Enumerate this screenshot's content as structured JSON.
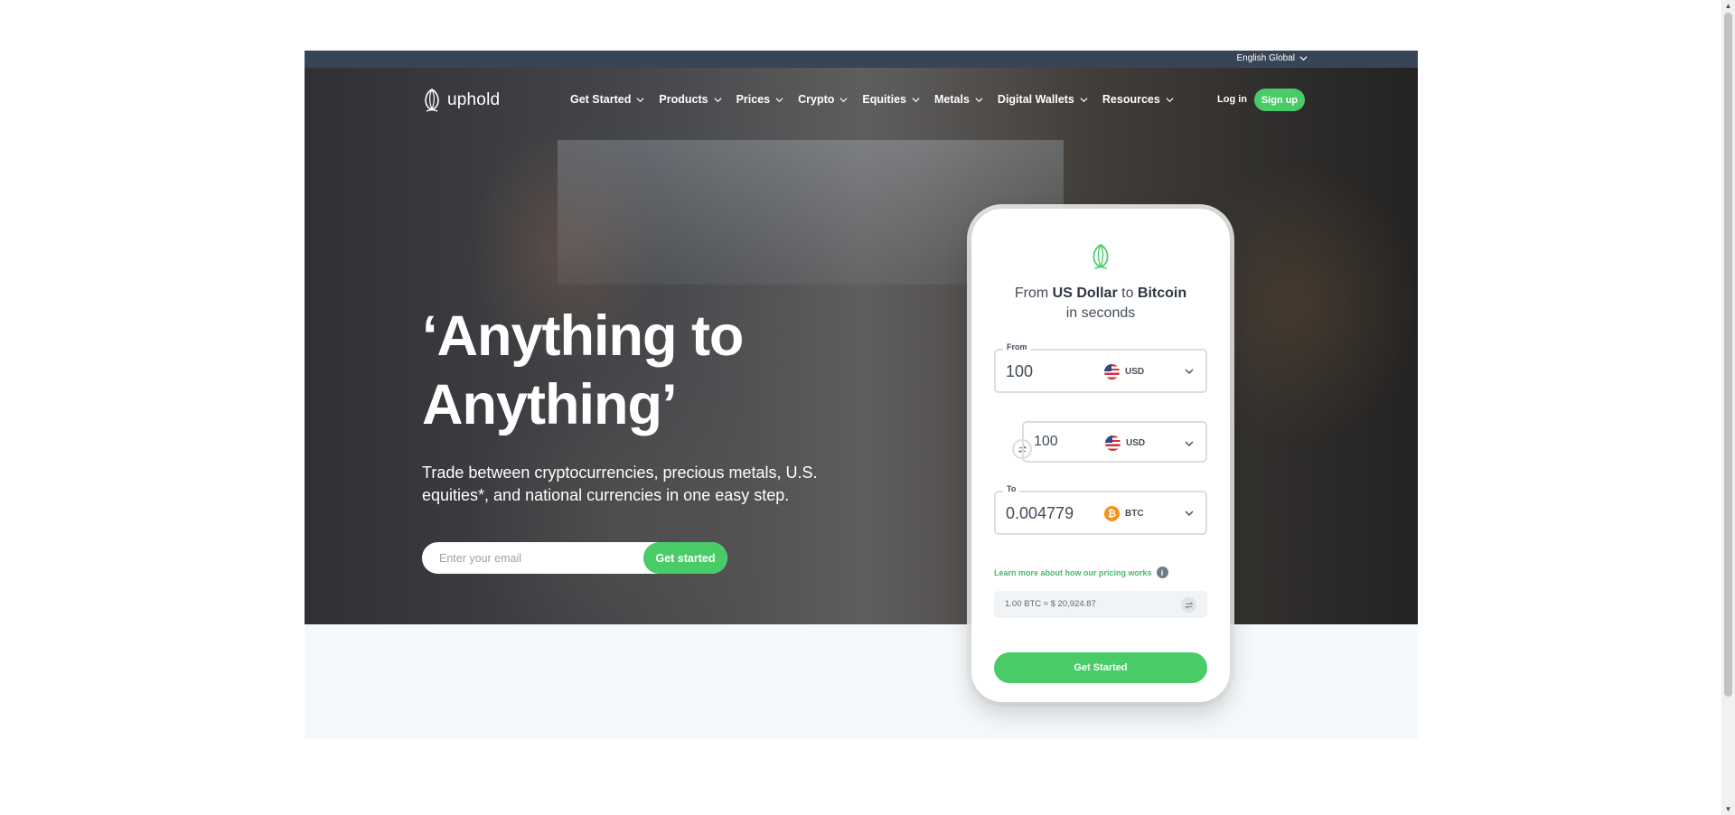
{
  "topbar": {
    "language": "English Global"
  },
  "nav": {
    "logo_text": "uphold",
    "items": [
      {
        "label": "Get Started"
      },
      {
        "label": "Products"
      },
      {
        "label": "Prices"
      },
      {
        "label": "Crypto"
      },
      {
        "label": "Equities"
      },
      {
        "label": "Metals"
      },
      {
        "label": "Digital Wallets"
      },
      {
        "label": "Resources"
      }
    ],
    "login": "Log in",
    "signup": "Sign up"
  },
  "hero": {
    "headline_line1": "‘Anything to",
    "headline_line2": "Anything’",
    "subtext": "Trade between cryptocurrencies, precious metals, U.S. equities*, and national currencies in one easy step.",
    "email_placeholder": "Enter your email",
    "cta": "Get started"
  },
  "converter": {
    "title_from_prefix": "From ",
    "title_from_currency": "US Dollar",
    "title_to_word": " to ",
    "title_to_currency": "Bitcoin",
    "title_line2": "in seconds",
    "from_label": "From",
    "from_value": "100",
    "from_currency": "USD",
    "mid_value": "100",
    "mid_currency": "USD",
    "to_label": "To",
    "to_value": "0.004779",
    "to_currency": "BTC",
    "learn_more": "Learn more about how our pricing works",
    "rate": "1.00 BTC ≈ $ 20,924.87",
    "cta": "Get Started"
  },
  "colors": {
    "accent": "#49cc68",
    "topbar": "#384557",
    "text_dark": "#434c59"
  }
}
